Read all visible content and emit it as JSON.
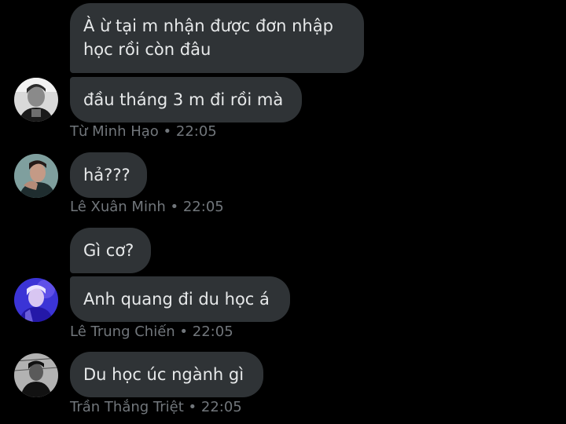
{
  "messages": [
    {
      "text_line1": "À ừ tại m nhận được đơn nhập",
      "text_line2": "học rồi còn đâu"
    },
    {
      "text": "đầu tháng 3 m đi rồi mà"
    },
    {
      "text": "hả???"
    },
    {
      "text": "Gì cơ?"
    },
    {
      "text": "Anh quang đi du học á"
    },
    {
      "text": "Du học úc ngành gì"
    }
  ],
  "metas": [
    {
      "sender": "Từ Minh Hạo",
      "separator": "•",
      "time": "22:05"
    },
    {
      "sender": "Lê Xuân Minh",
      "separator": "•",
      "time": "22:05"
    },
    {
      "sender": "Lê Trung Chiến",
      "separator": "•",
      "time": "22:05"
    },
    {
      "sender": "Trần Thắng Triệt",
      "separator": "•",
      "time": "22:05"
    }
  ],
  "colors": {
    "background": "#000000",
    "bubble": "#2f3336",
    "message_text": "#e7e9ea",
    "meta_text": "#71767b"
  }
}
